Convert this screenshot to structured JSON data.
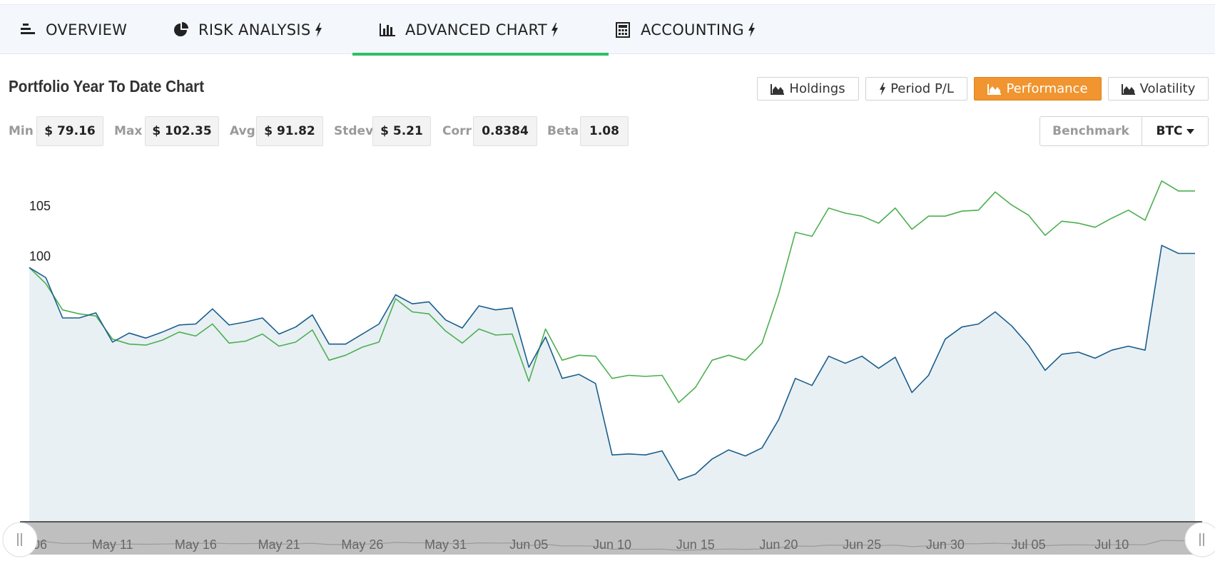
{
  "tabs": [
    {
      "label": "OVERVIEW",
      "icon": "layers-icon",
      "bolt": false
    },
    {
      "label": "RISK ANALYSIS",
      "icon": "pie-chart-icon",
      "bolt": true
    },
    {
      "label": "ADVANCED CHART",
      "icon": "bar-chart-icon",
      "bolt": true,
      "active": true
    },
    {
      "label": "ACCOUNTING",
      "icon": "calculator-icon",
      "bolt": true
    }
  ],
  "chart_title": "Portfolio Year To Date Chart",
  "view_buttons": [
    {
      "label": "Holdings",
      "icon": "area-chart-icon"
    },
    {
      "label": "Period P/L",
      "icon": "bolt-icon"
    },
    {
      "label": "Performance",
      "icon": "area-chart-icon",
      "active": true
    },
    {
      "label": "Volatility",
      "icon": "area-chart-icon"
    }
  ],
  "stats": {
    "min_label": "Min",
    "min_value": "$ 79.16",
    "max_label": "Max",
    "max_value": "$ 102.35",
    "avg_label": "Avg",
    "avg_value": "$ 91.82",
    "stdev_label": "Stdev",
    "stdev_value": "$ 5.21",
    "corr_label": "Corr",
    "corr_value": "0.8384",
    "beta_label": "Beta",
    "beta_value": "1.08"
  },
  "benchmark": {
    "label": "Benchmark",
    "selected": "BTC"
  },
  "colors": {
    "accent": "#f0952f",
    "tab_underline": "#2dbf6a",
    "portfolio_line": "#1b5e8c",
    "benchmark_line": "#4caf50",
    "area_fill": "#e8f0f4"
  },
  "chart_data": {
    "type": "line",
    "ylim": [
      75,
      107
    ],
    "yticks": [
      75,
      80,
      85,
      90,
      95,
      100,
      105
    ],
    "x_start_label": "06",
    "x_tick_labels": [
      "May 11",
      "May 16",
      "May 21",
      "May 26",
      "May 31",
      "Jun 05",
      "Jun 10",
      "Jun 15",
      "Jun 20",
      "Jun 25",
      "Jun 30",
      "Jul 05",
      "Jul 10"
    ],
    "x": [
      "May 06",
      "May 07",
      "May 08",
      "May 09",
      "May 10",
      "May 11",
      "May 12",
      "May 13",
      "May 14",
      "May 15",
      "May 16",
      "May 17",
      "May 18",
      "May 19",
      "May 20",
      "May 21",
      "May 22",
      "May 23",
      "May 24",
      "May 25",
      "May 26",
      "May 27",
      "May 28",
      "May 29",
      "May 30",
      "May 31",
      "Jun 01",
      "Jun 02",
      "Jun 03",
      "Jun 04",
      "Jun 05",
      "Jun 06",
      "Jun 07",
      "Jun 08",
      "Jun 09",
      "Jun 10",
      "Jun 11",
      "Jun 12",
      "Jun 13",
      "Jun 14",
      "Jun 15",
      "Jun 16",
      "Jun 17",
      "Jun 18",
      "Jun 19",
      "Jun 20",
      "Jun 21",
      "Jun 22",
      "Jun 23",
      "Jun 24",
      "Jun 25",
      "Jun 26",
      "Jun 27",
      "Jun 28",
      "Jun 29",
      "Jun 30",
      "Jul 01",
      "Jul 02",
      "Jul 03",
      "Jul 04",
      "Jul 05",
      "Jul 06",
      "Jul 07",
      "Jul 08",
      "Jul 09",
      "Jul 10",
      "Jul 11",
      "Jul 12",
      "Jul 13",
      "Jul 14",
      "Jul 15"
    ],
    "series": [
      {
        "values": [
          99.6,
          98.6,
          94.6,
          94.6,
          95.1,
          92.2,
          93.1,
          92.6,
          93.2,
          93.9,
          94.0,
          95.5,
          93.9,
          94.2,
          94.6,
          93.0,
          93.7,
          94.9,
          92.0,
          92.0,
          93.0,
          94.0,
          96.9,
          96.0,
          96.2,
          94.4,
          93.6,
          95.8,
          95.4,
          95.6,
          89.7,
          92.7,
          88.6,
          89.0,
          88.1,
          81.0,
          81.1,
          81.0,
          81.4,
          78.5,
          79.1,
          80.6,
          81.5,
          80.9,
          81.7,
          84.5,
          88.6,
          87.9,
          90.8,
          90.1,
          90.8,
          89.6,
          90.7,
          87.2,
          88.9,
          92.5,
          93.7,
          94.0,
          95.2,
          93.8,
          91.9,
          89.4,
          91.0,
          91.2,
          90.6,
          91.4,
          91.8,
          91.4,
          101.8,
          101.0,
          101.0
        ]
      },
      {
        "values": [
          99.6,
          98.0,
          95.4,
          95.0,
          94.8,
          92.5,
          92.0,
          91.9,
          92.4,
          93.2,
          92.8,
          94.0,
          92.1,
          92.3,
          93.0,
          91.8,
          92.2,
          93.4,
          90.4,
          90.9,
          91.7,
          92.2,
          96.5,
          95.2,
          95.0,
          93.3,
          92.1,
          93.5,
          92.9,
          93.0,
          88.3,
          93.5,
          90.4,
          90.9,
          90.8,
          88.6,
          88.9,
          88.8,
          88.9,
          86.2,
          87.7,
          90.4,
          90.9,
          90.4,
          92.1,
          97.0,
          103.1,
          102.7,
          105.5,
          105.0,
          104.7,
          104.0,
          105.5,
          103.4,
          104.7,
          104.7,
          105.2,
          105.3,
          107.1,
          105.8,
          104.8,
          102.8,
          104.2,
          104.0,
          103.6,
          104.5,
          105.3,
          104.3,
          108.2,
          107.2,
          107.2
        ]
      }
    ]
  }
}
